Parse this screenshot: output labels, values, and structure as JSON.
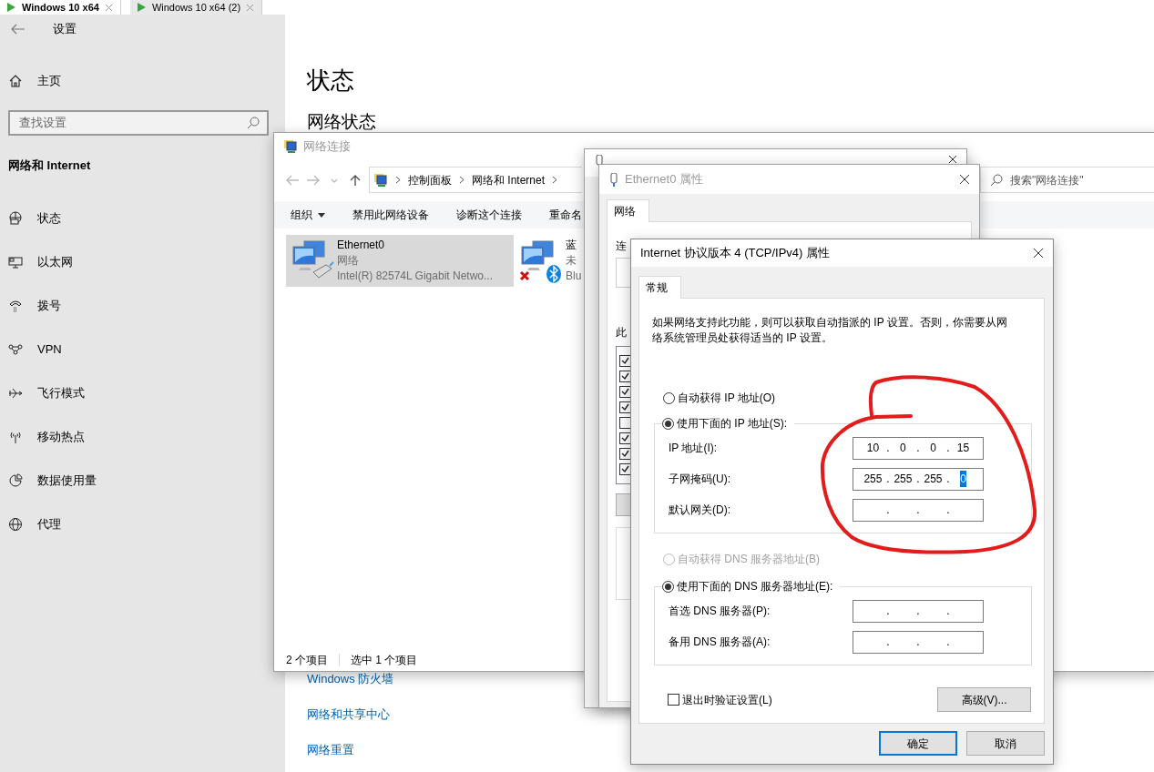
{
  "vm_tabs": [
    {
      "label": "Windows 10 x64",
      "selected": true
    },
    {
      "label": "Windows 10 x64 (2)",
      "selected": false
    }
  ],
  "settings": {
    "title": "设置",
    "home": "主页",
    "search_placeholder": "查找设置",
    "section": "网络和 Internet",
    "items": [
      {
        "label": "状态"
      },
      {
        "label": "以太网"
      },
      {
        "label": "拨号"
      },
      {
        "label": "VPN"
      },
      {
        "label": "飞行模式"
      },
      {
        "label": "移动热点"
      },
      {
        "label": "数据使用量"
      },
      {
        "label": "代理"
      }
    ],
    "page_title": "状态",
    "section_title": "网络状态",
    "links": [
      "Windows 防火墙",
      "网络和共享中心",
      "网络重置"
    ]
  },
  "network_connections": {
    "title": "网络连接",
    "breadcrumb": [
      "控制面板",
      "网络和 Internet"
    ],
    "search_placeholder": "搜索\"网络连接\"",
    "toolbar": [
      {
        "label": "组织",
        "kind": "dropdown"
      },
      {
        "label": "禁用此网络设备",
        "kind": "button"
      },
      {
        "label": "诊断这个连接",
        "kind": "button"
      },
      {
        "label": "重命名",
        "kind": "button"
      }
    ],
    "adapters": [
      {
        "name": "Ethernet0",
        "status": "网络",
        "device": "Intel(R) 82574L Gigabit Netwo...",
        "kind": "ethernet",
        "selected": true
      },
      {
        "name": "蓝",
        "status": "未",
        "device": "Blu",
        "kind": "bluetooth",
        "selected": false
      }
    ],
    "status_bar": [
      "2 个项目",
      "选中 1 个项目"
    ]
  },
  "ethernet_properties": {
    "title": "Ethernet0 属性",
    "tabs": [
      {
        "label": "网络",
        "selected": true
      }
    ],
    "fragments": [
      "连",
      "此"
    ],
    "components": [
      {
        "checked": true
      },
      {
        "checked": true
      },
      {
        "checked": true
      },
      {
        "checked": true
      },
      {
        "checked": false
      },
      {
        "checked": true
      },
      {
        "checked": true
      },
      {
        "checked": true
      }
    ]
  },
  "ipv4_dialog": {
    "title": "Internet 协议版本 4 (TCP/IPv4) 属性",
    "tabs": [
      {
        "label": "常规",
        "selected": true
      }
    ],
    "description": "如果网络支持此功能，则可以获取自动指派的 IP 设置。否则，你需要从网络系统管理员处获得适当的 IP 设置。",
    "separator": ".",
    "ip_mode": [
      {
        "label": "自动获得 IP 地址(O)",
        "selected": false
      },
      {
        "label": "使用下面的 IP 地址(S):",
        "selected": true
      }
    ],
    "ip_fields": [
      {
        "label": "IP 地址(I):",
        "octets": [
          {
            "text": "10",
            "highlighted": false
          },
          {
            "text": "0",
            "highlighted": false
          },
          {
            "text": "0",
            "highlighted": false
          },
          {
            "text": "15",
            "highlighted": false
          }
        ]
      },
      {
        "label": "子网掩码(U):",
        "octets": [
          {
            "text": "255",
            "highlighted": false
          },
          {
            "text": "255",
            "highlighted": false
          },
          {
            "text": "255",
            "highlighted": false
          },
          {
            "text": "0",
            "highlighted": true
          }
        ]
      },
      {
        "label": "默认网关(D):"
      }
    ],
    "dns_mode": [
      {
        "label": "自动获得 DNS 服务器地址(B)",
        "selected": false,
        "disabled": true
      },
      {
        "label": "使用下面的 DNS 服务器地址(E):",
        "selected": true,
        "disabled": false
      }
    ],
    "dns_fields": [
      {
        "label": "首选 DNS 服务器(P):"
      },
      {
        "label": "备用 DNS 服务器(A):"
      }
    ],
    "validate_on_exit": {
      "label": "退出时验证设置(L)",
      "checked": false
    },
    "advanced_button": "高级(V)...",
    "buttons": [
      {
        "label": "确定",
        "default": true
      },
      {
        "label": "取消",
        "default": false
      }
    ]
  }
}
